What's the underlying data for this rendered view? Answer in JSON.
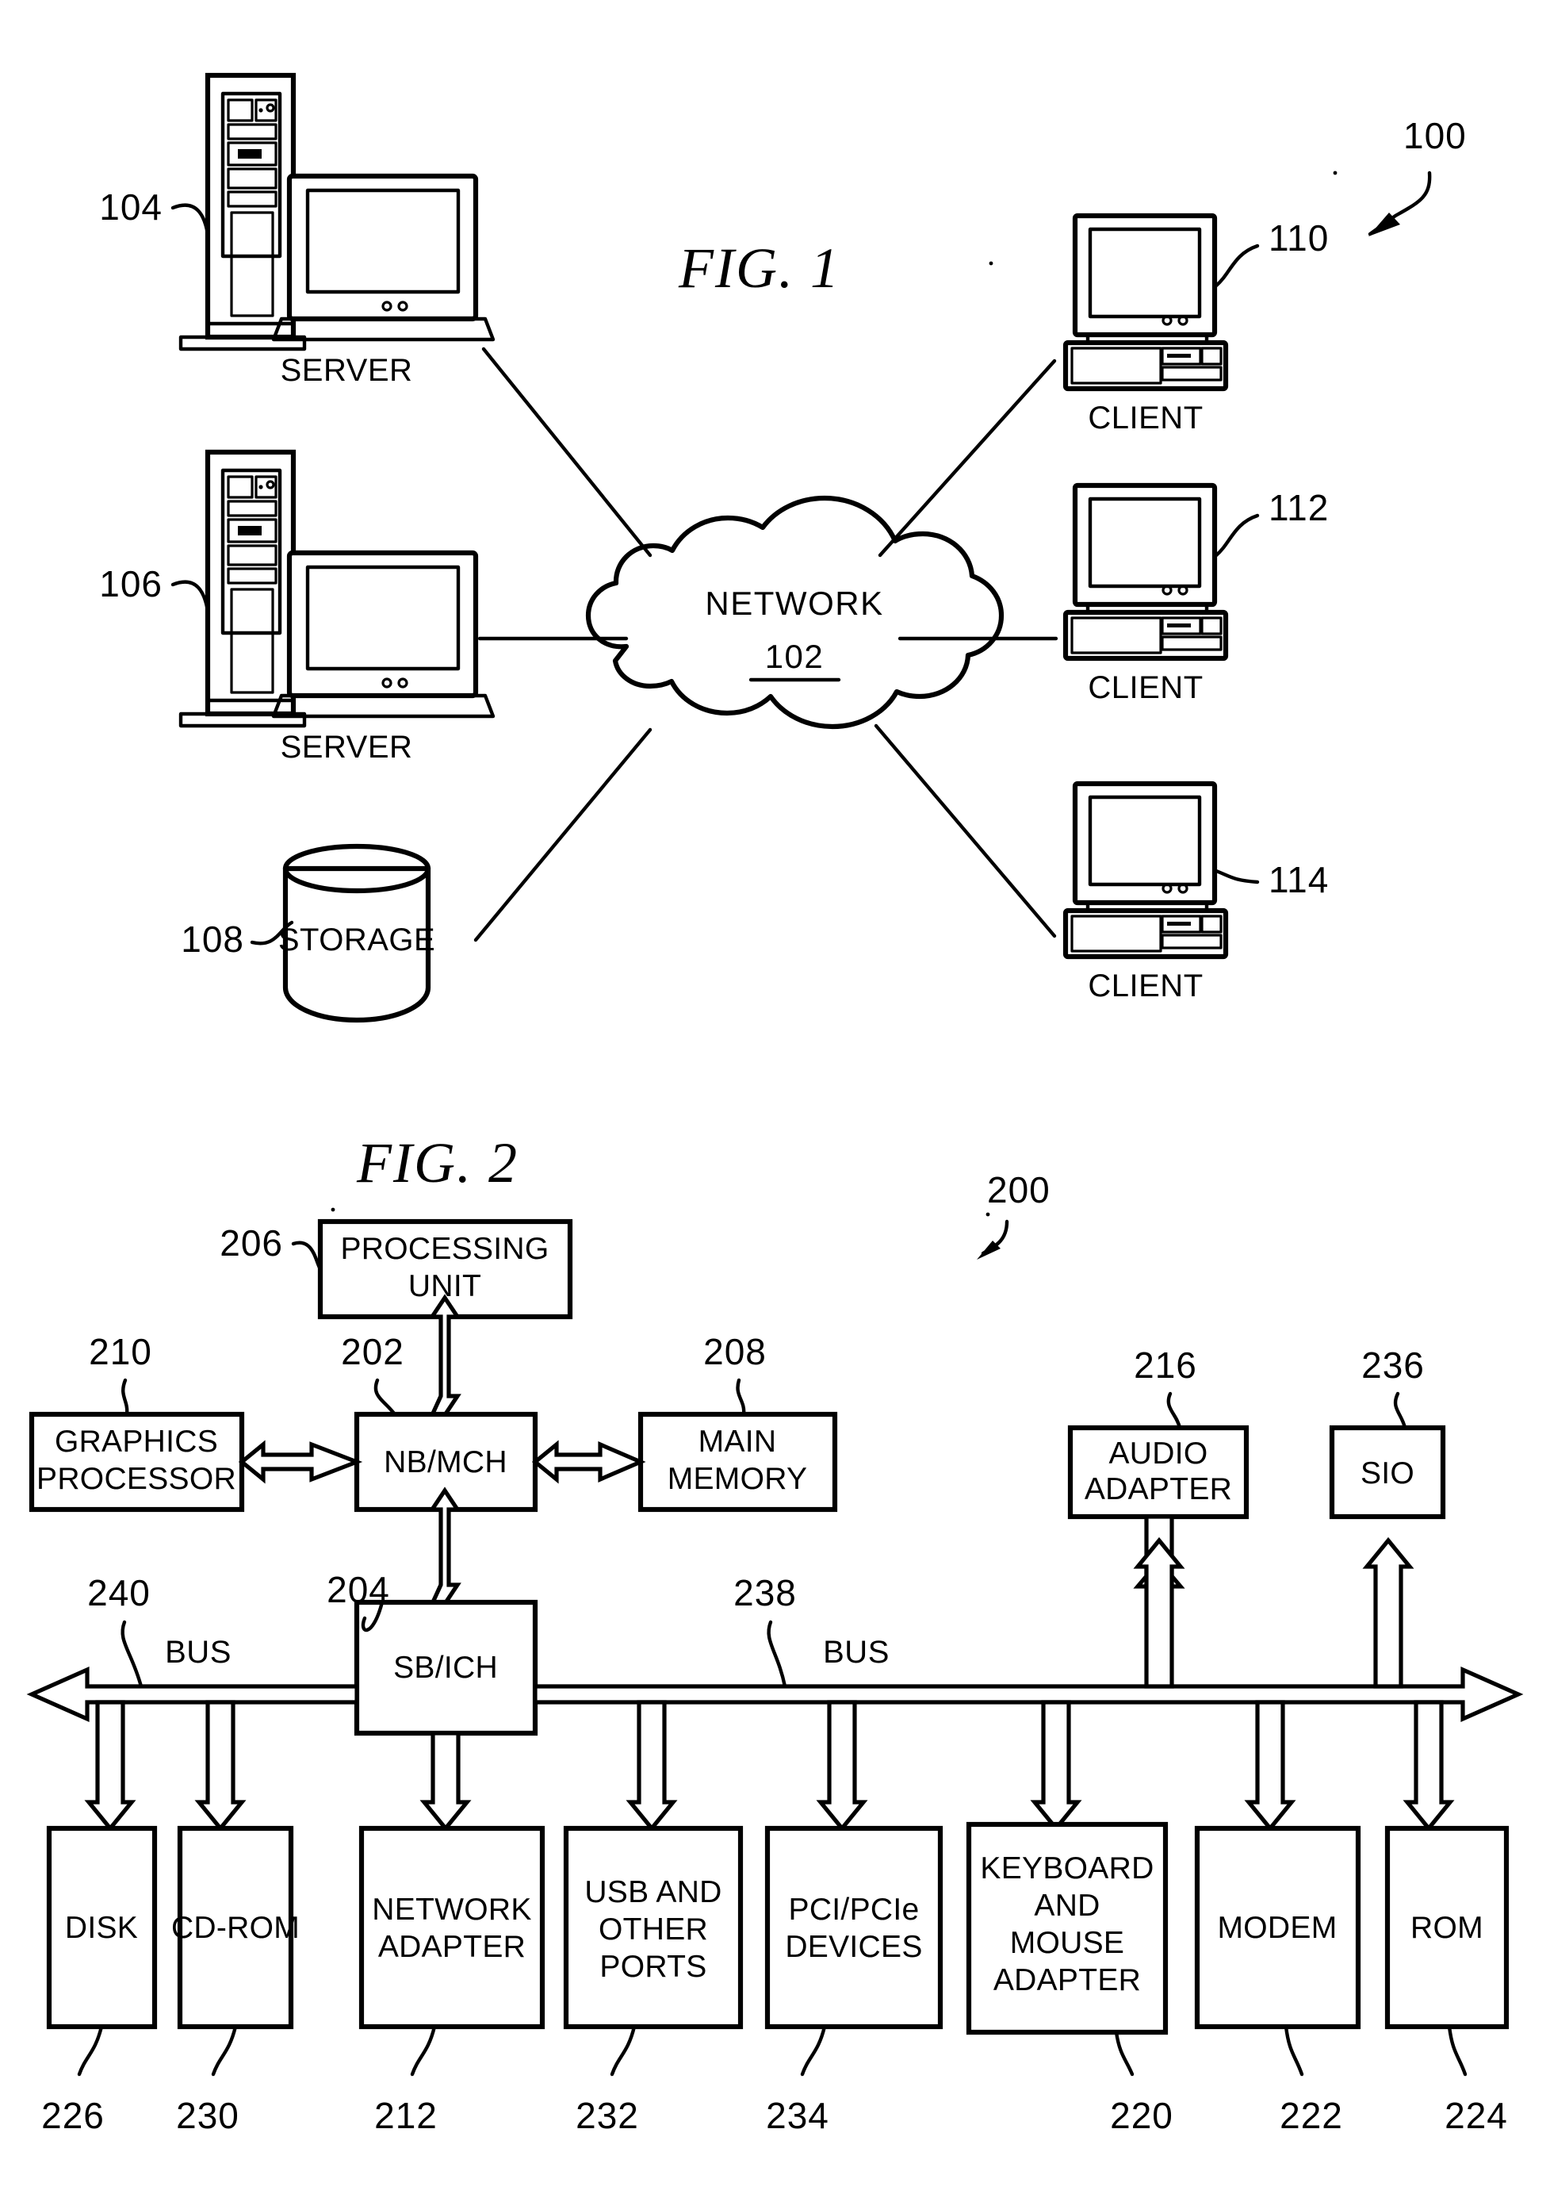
{
  "figure1": {
    "title": "FIG. 1",
    "system_ref": "100",
    "network": {
      "label": "NETWORK",
      "ref": "102"
    },
    "servers": [
      {
        "label": "SERVER",
        "ref": "104"
      },
      {
        "label": "SERVER",
        "ref": "106"
      }
    ],
    "storage": {
      "label": "STORAGE",
      "ref": "108"
    },
    "clients": [
      {
        "label": "CLIENT",
        "ref": "110"
      },
      {
        "label": "CLIENT",
        "ref": "112"
      },
      {
        "label": "CLIENT",
        "ref": "114"
      }
    ]
  },
  "figure2": {
    "title": "FIG. 2",
    "system_ref": "200",
    "bus_label_left": "BUS",
    "bus_label_right": "BUS",
    "bus_ref_left": "240",
    "bus_ref_right": "238",
    "blocks": [
      {
        "id": "processing-unit",
        "label": "PROCESSING UNIT",
        "lines": [
          "PROCESSING",
          "UNIT"
        ],
        "ref": "206"
      },
      {
        "id": "graphics-processor",
        "label": "GRAPHICS PROCESSOR",
        "lines": [
          "GRAPHICS",
          "PROCESSOR"
        ],
        "ref": "210"
      },
      {
        "id": "nb-mch",
        "label": "NB/MCH",
        "lines": [
          "NB/MCH"
        ],
        "ref": "202"
      },
      {
        "id": "main-memory",
        "label": "MAIN MEMORY",
        "lines": [
          "MAIN",
          "MEMORY"
        ],
        "ref": "208"
      },
      {
        "id": "audio-adapter",
        "label": "AUDIO ADAPTER",
        "lines": [
          "AUDIO",
          "ADAPTER"
        ],
        "ref": "216"
      },
      {
        "id": "sio",
        "label": "SIO",
        "lines": [
          "SIO"
        ],
        "ref": "236"
      },
      {
        "id": "sb-ich",
        "label": "SB/ICH",
        "lines": [
          "SB/ICH"
        ],
        "ref": "204"
      },
      {
        "id": "disk",
        "label": "DISK",
        "lines": [
          "DISK"
        ],
        "ref": "226"
      },
      {
        "id": "cd-rom",
        "label": "CD-ROM",
        "lines": [
          "CD-ROM"
        ],
        "ref": "230"
      },
      {
        "id": "network-adapter",
        "label": "NETWORK ADAPTER",
        "lines": [
          "NETWORK",
          "ADAPTER"
        ],
        "ref": "212"
      },
      {
        "id": "usb-and-other-ports",
        "label": "USB AND OTHER PORTS",
        "lines": [
          "USB AND",
          "OTHER",
          "PORTS"
        ],
        "ref": "232"
      },
      {
        "id": "pci-pcie-devices",
        "label": "PCI/PCIe DEVICES",
        "lines": [
          "PCI/PCIe",
          "DEVICES"
        ],
        "ref": "234"
      },
      {
        "id": "keyboard-and-mouse-adapter",
        "label": "KEYBOARD AND MOUSE ADAPTER",
        "lines": [
          "KEYBOARD",
          "AND",
          "MOUSE",
          "ADAPTER"
        ],
        "ref": "220"
      },
      {
        "id": "modem",
        "label": "MODEM",
        "lines": [
          "MODEM"
        ],
        "ref": "222"
      },
      {
        "id": "rom",
        "label": "ROM",
        "lines": [
          "ROM"
        ],
        "ref": "224"
      }
    ]
  },
  "colors": {
    "ink": "#000000",
    "paper": "#ffffff"
  }
}
